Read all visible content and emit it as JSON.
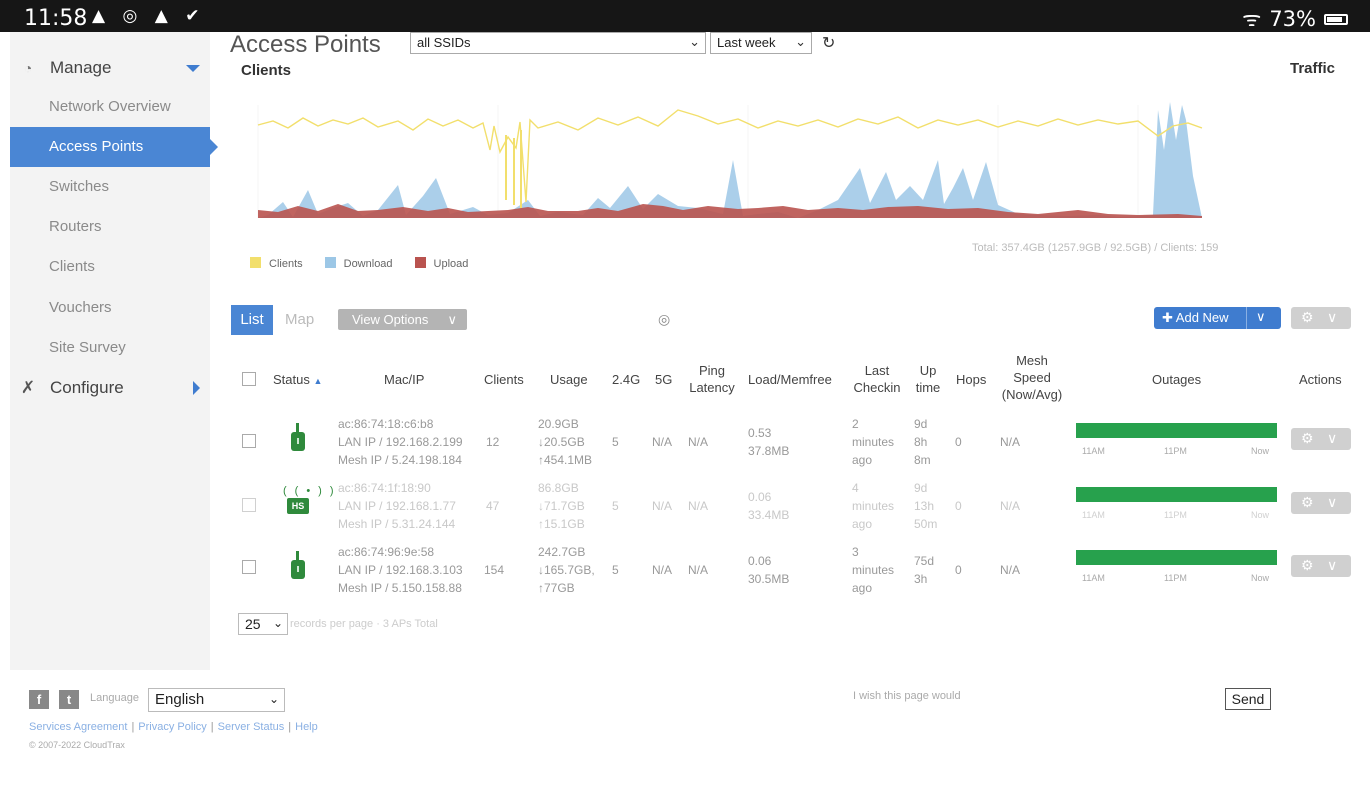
{
  "status_bar": {
    "time": "11:58",
    "notification_icons": "▲ ◎ ▲ ✔",
    "wifi": "ᯤ",
    "battery": "73%"
  },
  "sidebar": {
    "manage_label": "Manage",
    "configure_label": "Configure",
    "items": [
      {
        "label": "Network Overview"
      },
      {
        "label": "Access Points",
        "active": true
      },
      {
        "label": "Switches"
      },
      {
        "label": "Routers"
      },
      {
        "label": "Clients"
      },
      {
        "label": "Vouchers"
      },
      {
        "label": "Site Survey"
      }
    ]
  },
  "header": {
    "title": "Access Points",
    "ssid_select": "all SSIDs",
    "range_select": "Last week",
    "clients_heading": "Clients",
    "traffic_heading": "Traffic"
  },
  "chart": {
    "legend": [
      "Clients",
      "Download",
      "Upload"
    ],
    "colors": {
      "clients": "#f2df6c",
      "download": "#9cc7e6",
      "upload": "#b9534f"
    },
    "total": "Total: 357.4GB (1257.9GB / 92.5GB) / Clients: 159"
  },
  "toolbar": {
    "list_label": "List",
    "map_label": "Map",
    "view_options_label": "View Options",
    "add_new_label": "Add New"
  },
  "table": {
    "headers": {
      "status": "Status",
      "mac_ip": "Mac/IP",
      "clients": "Clients",
      "usage": "Usage",
      "band24": "2.4G",
      "band5": "5G",
      "ping_latency": "Ping Latency",
      "load_memfree": "Load/Memfree",
      "last_checkin": "Last Checkin",
      "uptime": "Up time",
      "hops": "Hops",
      "mesh_speed": "Mesh Speed (Now/Avg)",
      "outages": "Outages",
      "actions": "Actions"
    },
    "rows": [
      {
        "mac": "ac:86:74:18:c6:b8",
        "lan_ip": "LAN IP / 192.168.2.199",
        "mesh_ip": "Mesh IP / 5.24.198.184",
        "clients": "12",
        "usage_total": "20.9GB",
        "usage_down": "↓20.5GB",
        "usage_up": "↑454.1MB",
        "band24": "5",
        "band5": "N/A",
        "ping": "N/A",
        "load": "0.53",
        "memfree": "37.8MB",
        "checkin_1": "2",
        "checkin_2": "minutes",
        "checkin_3": "ago",
        "uptime_1": "9d",
        "uptime_2": "8h",
        "uptime_3": "8m",
        "hops": "0",
        "mesh_speed": "N/A",
        "outage_labels": [
          "11AM",
          "11PM",
          "Now"
        ]
      },
      {
        "mac": "ac:86:74:1f:18:90",
        "lan_ip": "LAN IP / 192.168.1.77",
        "mesh_ip": "Mesh IP / 5.31.24.144",
        "clients": "47",
        "usage_total": "86.8GB",
        "usage_down": "↓71.7GB",
        "usage_up": "↑15.1GB",
        "band24": "5",
        "band5": "N/A",
        "ping": "N/A",
        "load": "0.06",
        "memfree": "33.4MB",
        "checkin_1": "4",
        "checkin_2": "minutes",
        "checkin_3": "ago",
        "uptime_1": "9d",
        "uptime_2": "13h",
        "uptime_3": "50m",
        "hops": "0",
        "mesh_speed": "N/A",
        "outage_labels": [
          "11AM",
          "11PM",
          "Now"
        ]
      },
      {
        "mac": "ac:86:74:96:9e:58",
        "lan_ip": "LAN IP / 192.168.3.103",
        "mesh_ip": "Mesh IP / 5.150.158.88",
        "clients": "154",
        "usage_total": "242.7GB",
        "usage_down": "↓165.7GB,",
        "usage_up": "↑77GB",
        "band24": "5",
        "band5": "N/A",
        "ping": "N/A",
        "load": "0.06",
        "memfree": "30.5MB",
        "checkin_1": "3",
        "checkin_2": "minutes",
        "checkin_3": "ago",
        "uptime_1": "75d",
        "uptime_2": "3h",
        "uptime_3": "",
        "hops": "0",
        "mesh_speed": "N/A",
        "outage_labels": [
          "11AM",
          "11PM",
          "Now"
        ]
      }
    ]
  },
  "pager": {
    "per_page": "25",
    "info": "records per page · 3 APs Total"
  },
  "footer": {
    "language_label": "Language",
    "language_value": "English",
    "links": [
      "Services Agreement",
      "Privacy Policy",
      "Server Status",
      "Help"
    ],
    "copyright": "© 2007-2022 CloudTrax",
    "wish_placeholder": "I wish this page would",
    "send_label": "Send"
  }
}
